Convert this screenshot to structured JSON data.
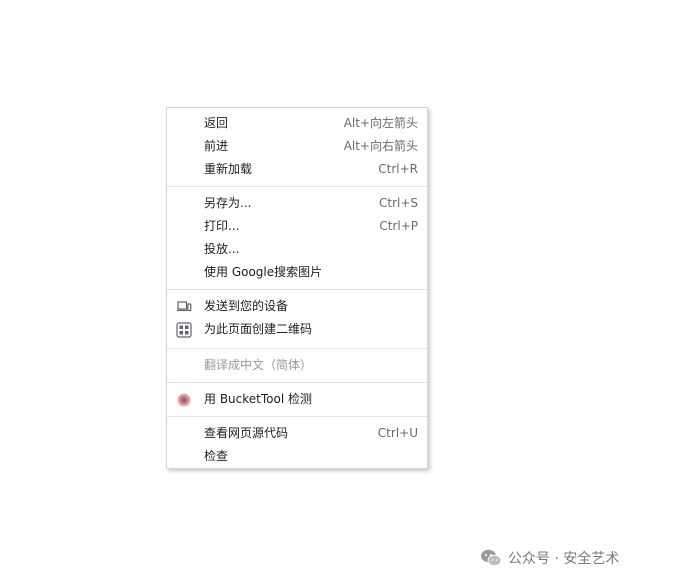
{
  "menu": {
    "items": [
      {
        "label": "返回",
        "shortcut": "Alt+向左箭头"
      },
      {
        "label": "前进",
        "shortcut": "Alt+向右箭头"
      },
      {
        "label": "重新加载",
        "shortcut": "Ctrl+R"
      },
      {
        "label": "另存为...",
        "shortcut": "Ctrl+S"
      },
      {
        "label": "打印...",
        "shortcut": "Ctrl+P"
      },
      {
        "label": "投放..."
      },
      {
        "label": "使用 Google搜索图片"
      },
      {
        "label": "发送到您的设备",
        "icon": "devices-icon"
      },
      {
        "label": "为此页面创建二维码",
        "icon": "qr-code-icon"
      },
      {
        "label": "翻译成中文（简体）"
      },
      {
        "label": "用 BucketTool 检测",
        "icon": "bucket-tool-extension-icon"
      },
      {
        "label": "查看网页源代码",
        "shortcut": "Ctrl+U"
      },
      {
        "label": "检查"
      }
    ]
  },
  "watermark": {
    "text": "公众号 · 安全艺术",
    "icon": "wechat-logo-icon"
  },
  "colors": {
    "text": "#202124",
    "disabled_text": "#9a9a9a",
    "separator": "#e3e3e3",
    "menu_border": "#d6d6d6"
  }
}
